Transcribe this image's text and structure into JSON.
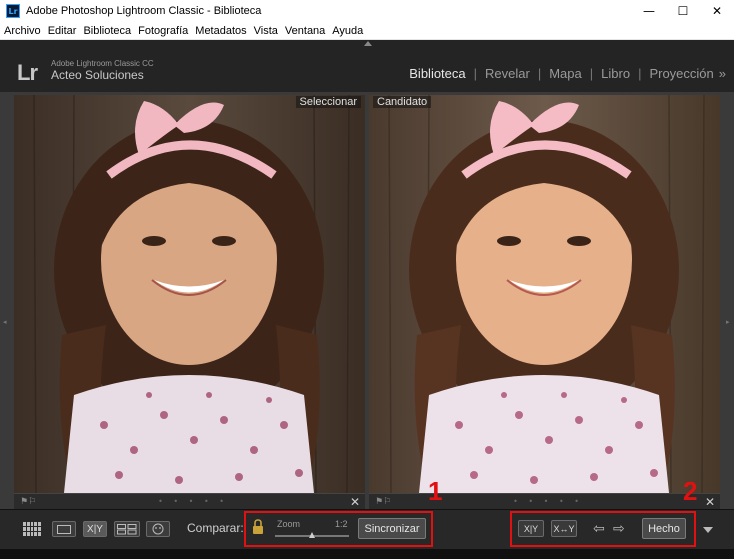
{
  "window": {
    "title": "Adobe Photoshop Lightroom Classic - Biblioteca",
    "app_icon": "Lr",
    "minimize": "—",
    "maximize": "☐",
    "close": "✕"
  },
  "menubar": [
    "Archivo",
    "Editar",
    "Biblioteca",
    "Fotografía",
    "Metadatos",
    "Vista",
    "Ventana",
    "Ayuda"
  ],
  "identity": {
    "logo": "Lr",
    "product": "Adobe Lightroom Classic CC",
    "org": "Acteo Soluciones"
  },
  "modules": {
    "items": [
      "Biblioteca",
      "Revelar",
      "Mapa",
      "Libro",
      "Proyección"
    ],
    "active": "Biblioteca",
    "more": "»"
  },
  "compare": {
    "left_label": "Seleccionar",
    "right_label": "Candidato",
    "close": "✕",
    "dots": "• • • • •"
  },
  "toolbar": {
    "compare_label": "Comparar:",
    "zoom_label": "Zoom",
    "zoom_ratio": "1:2",
    "zoom_level": 0.5,
    "sync_button": "Sincronizar",
    "done_button": "Hecho",
    "xy_label": "X|Y",
    "swap_label": "X↔Y"
  },
  "annotations": {
    "box1_number": "1",
    "box2_number": "2",
    "color": "#e11111"
  },
  "icons": [
    "grid-icon",
    "loupe-icon",
    "compare-icon",
    "survey-icon",
    "people-icon",
    "lock-icon",
    "swap-icon",
    "make-select-icon",
    "arrow-left-icon",
    "arrow-right-icon",
    "dropdown-icon"
  ]
}
